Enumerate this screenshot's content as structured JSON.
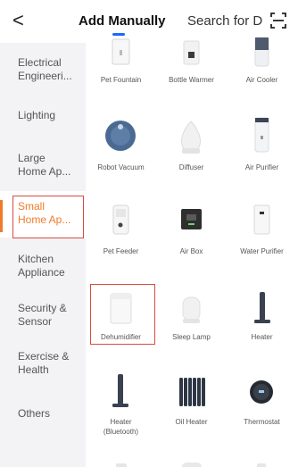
{
  "header": {
    "back_glyph": "<",
    "tab_add_manually": "Add Manually",
    "tab_search": "Search for D"
  },
  "sidebar": {
    "items": [
      {
        "label": "Electrical\nEngineeri...",
        "active": false
      },
      {
        "label": "Lighting",
        "active": false
      },
      {
        "label": "Large\nHome Ap...",
        "active": false
      },
      {
        "label": "Small\nHome Ap...",
        "active": true
      },
      {
        "label": "Kitchen\nAppliance",
        "active": false
      },
      {
        "label": "Security &\nSensor",
        "active": false
      },
      {
        "label": "Exercise &\nHealth",
        "active": false
      },
      {
        "label": "Others",
        "active": false
      }
    ]
  },
  "devices": [
    {
      "name": "Pet Fountain",
      "icon": "pet-fountain-icon"
    },
    {
      "name": "Bottle Warmer",
      "icon": "bottle-warmer-icon"
    },
    {
      "name": "Air Cooler",
      "icon": "air-cooler-icon"
    },
    {
      "name": "Robot Vacuum",
      "icon": "robot-vacuum-icon"
    },
    {
      "name": "Diffuser",
      "icon": "diffuser-icon"
    },
    {
      "name": "Air Purifier",
      "icon": "air-purifier-icon"
    },
    {
      "name": "Pet Feeder",
      "icon": "pet-feeder-icon"
    },
    {
      "name": "Air Box",
      "icon": "air-box-icon"
    },
    {
      "name": "Water Purifier",
      "icon": "water-purifier-icon"
    },
    {
      "name": "Dehumidifier",
      "icon": "dehumidifier-icon"
    },
    {
      "name": "Sleep Lamp",
      "icon": "sleep-lamp-icon"
    },
    {
      "name": "Heater",
      "icon": "heater-icon"
    },
    {
      "name": "Heater\n(Bluetooth)",
      "icon": "heater-bluetooth-icon"
    },
    {
      "name": "Oil Heater",
      "icon": "oil-heater-icon"
    },
    {
      "name": "Thermostat",
      "icon": "thermostat-icon"
    }
  ],
  "colors": {
    "accent": "#f07a2a",
    "tab_indicator": "#1f66ff",
    "highlight_box": "#d94b3f",
    "sidebar_bg": "#f3f3f5"
  }
}
